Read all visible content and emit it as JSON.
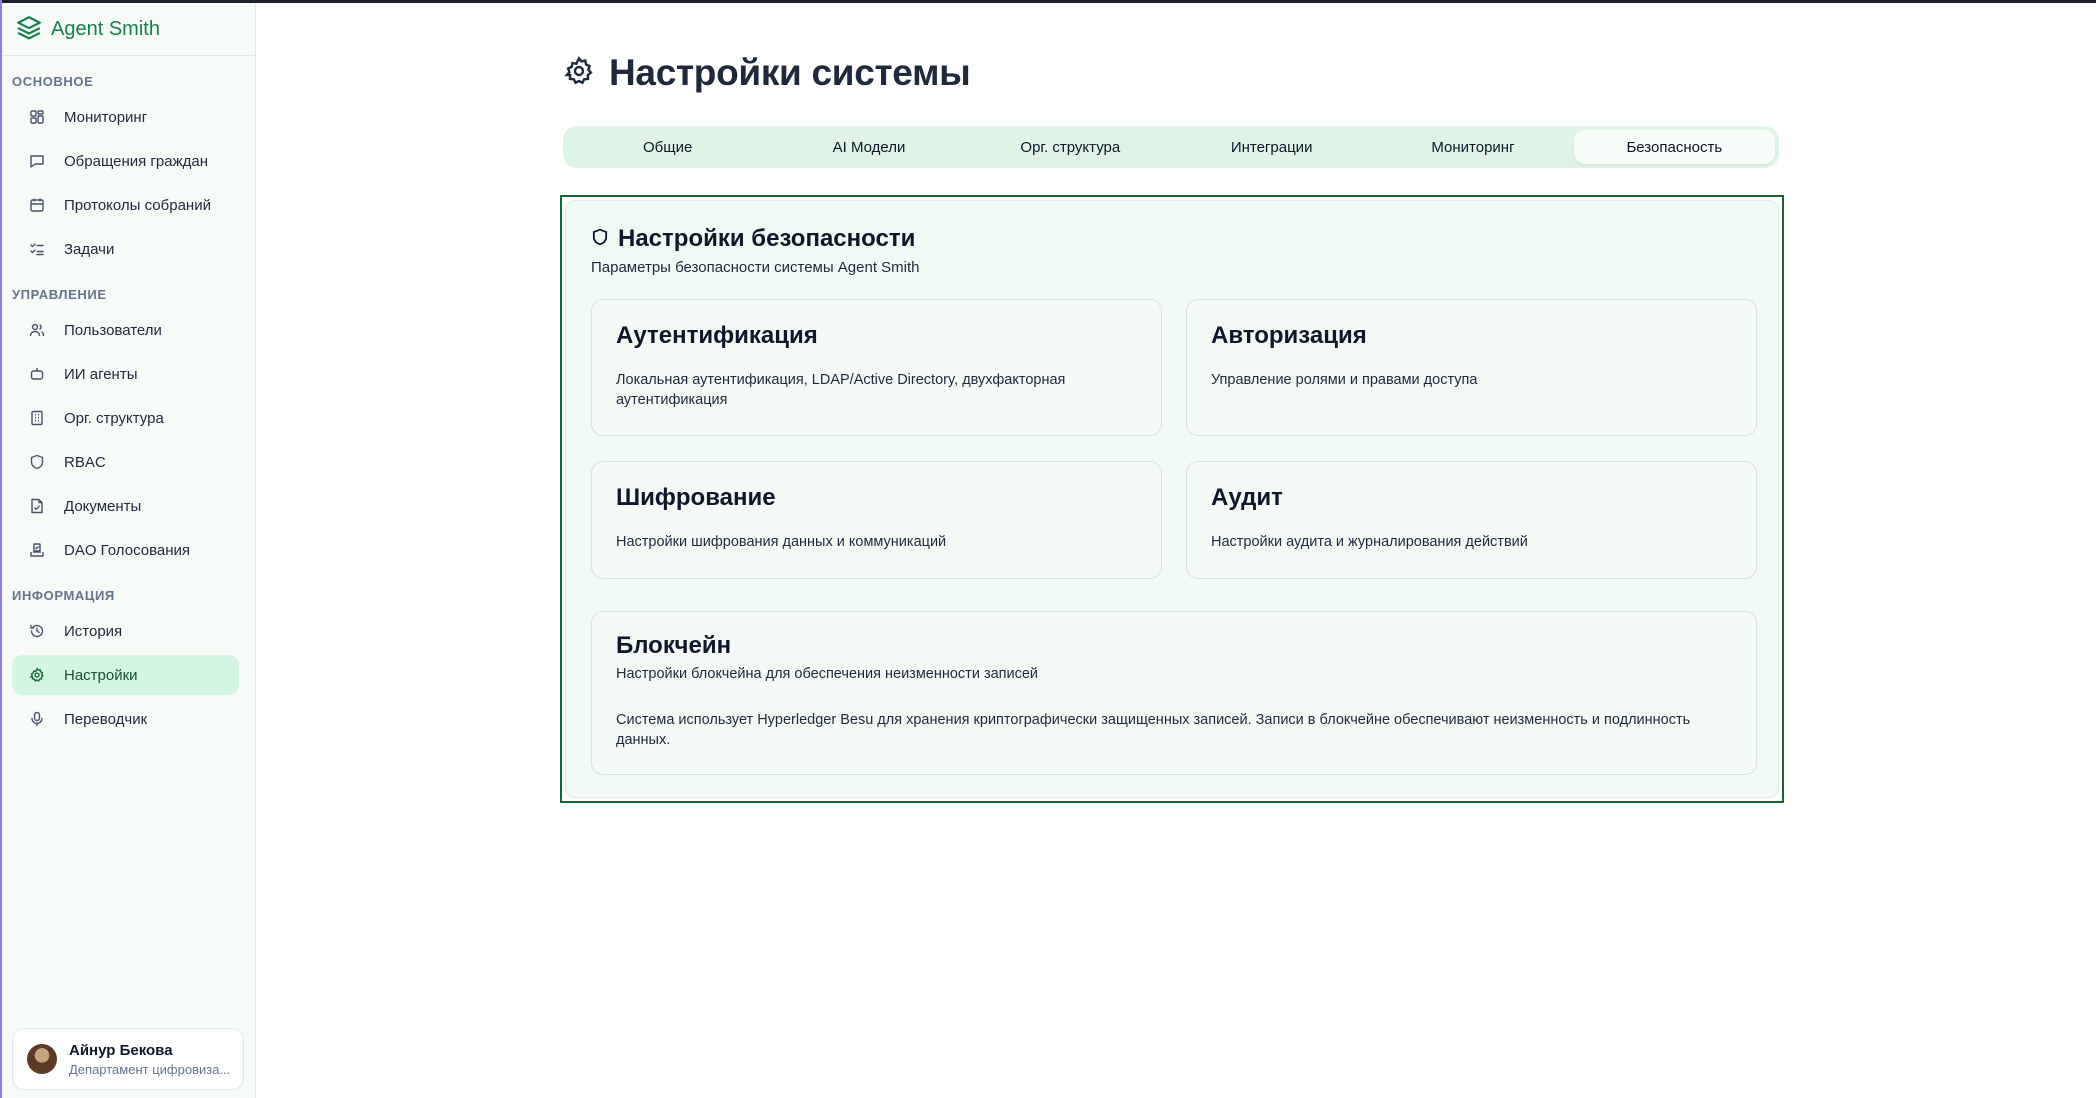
{
  "app": {
    "name": "Agent Smith",
    "brand_color": "#16804a"
  },
  "sidebar": {
    "sections": [
      {
        "title": "ОСНОВНОЕ",
        "items": [
          {
            "label": "Мониторинг",
            "icon": "grid-icon"
          },
          {
            "label": "Обращения граждан",
            "icon": "message-square-icon"
          },
          {
            "label": "Протоколы собраний",
            "icon": "calendar-icon"
          },
          {
            "label": "Задачи",
            "icon": "checklist-icon"
          }
        ]
      },
      {
        "title": "УПРАВЛЕНИЕ",
        "items": [
          {
            "label": "Пользователи",
            "icon": "users-icon"
          },
          {
            "label": "ИИ агенты",
            "icon": "bot-icon"
          },
          {
            "label": "Орг. структура",
            "icon": "building-icon"
          },
          {
            "label": "RBAC",
            "icon": "shield-icon"
          },
          {
            "label": "Документы",
            "icon": "file-check-icon"
          },
          {
            "label": "DAO Голосования",
            "icon": "vote-icon"
          }
        ]
      },
      {
        "title": "ИНФОРМАЦИЯ",
        "items": [
          {
            "label": "История",
            "icon": "history-icon"
          },
          {
            "label": "Настройки",
            "icon": "settings-icon",
            "active": true
          },
          {
            "label": "Переводчик",
            "icon": "mic-icon"
          }
        ]
      }
    ],
    "user": {
      "name": "Айнур Бекова",
      "department": "Департамент цифровиза..."
    }
  },
  "page": {
    "title": "Настройки системы",
    "tabs": [
      {
        "label": "Общие"
      },
      {
        "label": "AI Модели"
      },
      {
        "label": "Орг. структура"
      },
      {
        "label": "Интеграции"
      },
      {
        "label": "Мониторинг"
      },
      {
        "label": "Безопасность",
        "active": true
      }
    ],
    "security": {
      "title": "Настройки безопасности",
      "subtitle": "Параметры безопасности системы Agent Smith",
      "cards": {
        "auth": {
          "title": "Аутентификация",
          "description": "Локальная аутентификация, LDAP/Active Directory, двухфакторная аутентификация"
        },
        "authz": {
          "title": "Авторизация",
          "description": "Управление ролями и правами доступа"
        },
        "encryption": {
          "title": "Шифрование",
          "description": "Настройки шифрования данных и коммуникаций"
        },
        "audit": {
          "title": "Аудит",
          "description": "Настройки аудита и журналирования действий"
        },
        "blockchain": {
          "title": "Блокчейн",
          "description": "Настройки блокчейна для обеспечения неизменности записей",
          "note": "Система использует Hyperledger Besu для хранения криптографически защищенных записей. Записи в блокчейне обеспечивают неизменность и подлинность данных."
        }
      }
    }
  },
  "colors": {
    "active_nav_bg": "#d3f5e1",
    "tabs_bg": "#dff3e7",
    "panel_border": "#166534"
  }
}
